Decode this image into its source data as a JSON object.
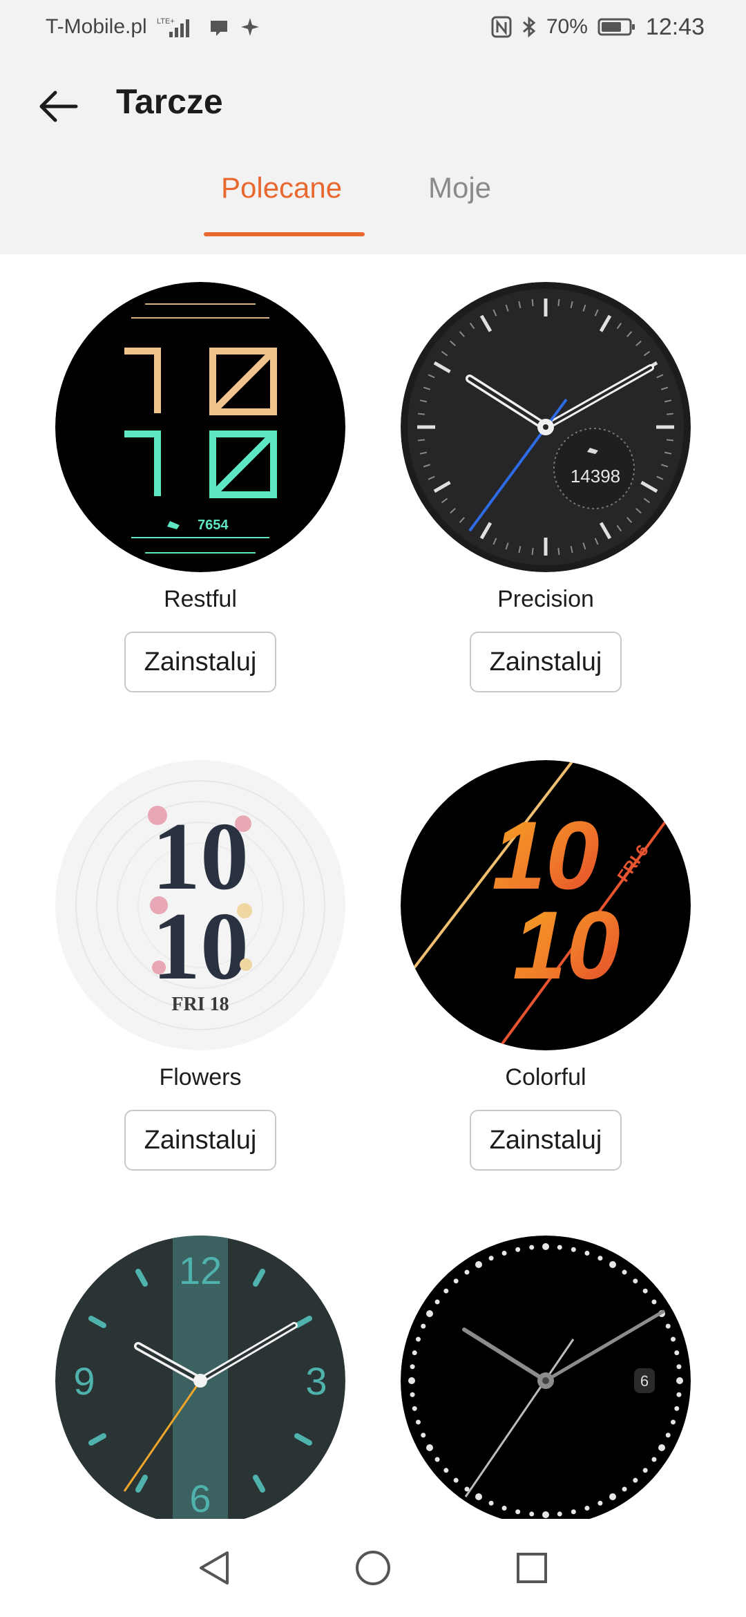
{
  "status_bar": {
    "carrier": "T-Mobile.pl",
    "network": "LTE+",
    "battery": "70%",
    "time": "12:43",
    "icons": [
      "signal-icon",
      "cast-icon",
      "sparkle-icon",
      "nfc-icon",
      "bluetooth-icon",
      "battery-icon"
    ]
  },
  "header": {
    "title": "Tarcze",
    "back_icon": "arrow-left-icon"
  },
  "tabs": [
    {
      "label": "Polecane",
      "active": true
    },
    {
      "label": "Moje",
      "active": false
    }
  ],
  "faces": [
    {
      "name": "Restful",
      "button": "Zainstaluj",
      "time_text": "10 10",
      "steps": "7654"
    },
    {
      "name": "Precision",
      "button": "Zainstaluj",
      "steps": "14398"
    },
    {
      "name": "Flowers",
      "button": "Zainstaluj",
      "digits": "10",
      "date": "FRI 18"
    },
    {
      "name": "Colorful",
      "button": "Zainstaluj",
      "digits": "10",
      "date": "FRI 6"
    },
    {
      "name": "",
      "button": "",
      "numerals": [
        "12",
        "3",
        "6",
        "9"
      ]
    },
    {
      "name": "",
      "button": "",
      "date": "6"
    }
  ],
  "colors": {
    "accent": "#e9682f",
    "header_bg": "#f2f2f2"
  }
}
